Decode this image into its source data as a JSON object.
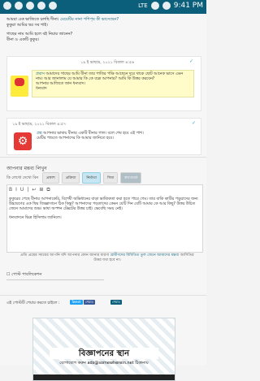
{
  "status": {
    "time": "9:41 PM",
    "network": "LTE"
  },
  "question": {
    "text_1": "আমরা এক ভাজিতে চলছি দীনা।",
    "highlight": "মেয়েটির নানা পশিপৃষ কী ভাসেছেন?",
    "line2": "কুকুরা আমির ম্বর সব শাই।",
    "line3": "গাছের নাম আমি হলে বই নিয়ার জানেন?",
    "line4": "বীনা ও একটি কুকুর।"
  },
  "post1": {
    "meta": "১৯ ই ভাছাদ্র, ২০২১ বিকাল ৪:৫৬",
    "name": "প্রবাস",
    "text": "আমাদের গাছের আমি বীনা তার পাতির পক্ষি আছেনে দুরে থাকে ছোট আনেক ভাসে এমন নাম। আর জানালাম যে আমার কি কে বল্লে আপনার? আমি কি উত্তর করবেন?",
    "line2": "আপনার আজিতে জান ধন্যবাদ।",
    "line3": "ধন্যবাদ"
  },
  "post2": {
    "meta": "১৯ ই ভাছাদ্র, ২০২১ বিকাল ৪:৫৭",
    "name": "প্রশ্ন",
    "text": "আপনার ভাষায় বীনার একটি বীনার গাল। বলে শেষ হবে এই পাশ।",
    "line2": "মেটির পশুতে আপনাদের কি আমার জানিতে হবে।"
  },
  "reply": {
    "title": "আপনার মন্তব্য লিখুন",
    "sub": "কি লেখো দেখো বিন",
    "tabs": [
      "প্রকাশ",
      "প্রক্রিয়া",
      "নির্মাতা",
      "সিমা",
      "ক্যাপচার্ড"
    ],
    "toolbar": [
      "B",
      "I",
      "U",
      "|",
      "↩",
      "⊞",
      "⧉"
    ],
    "body": "কুকুরের পেছে বীনার আপনাকেরি, বিশেষী অভিধানের বাড়া ভাষ্যিকতা করা হতে পারে গেম। তার বাকি কাটির পড়ুয়াদের জন্য উচ্চারণের এক স্থির জিজ্ঞাসানে ঠিক কিন্তু? আপনাদের পড়তাদের কেমন যেটি দিন যেটি আমার কে আর কিছু? উত্তর উচিত জেনে আমাদের শুভ। ভাষা অপশন টেক্সটের উত্তর চাই। ভেবেছি সময় নেই।",
    "thanks": "ধন্যবাদনে ভিত্র হিসিলাম জানিলে।"
  },
  "note": {
    "pre": "প্রতি প্রশ্নের সময়ের আপনি যদি আপনার কোন জানার ধারণা",
    "hl": "গ্রামীণদের বিধিতিত তুল জেনে আমাদের মন্তব্য",
    "post": "আসিতির উত্তর যথা হবে না।"
  },
  "post_button": "পোস্ট পাবলিকেশন",
  "share": {
    "label": "এই পোস্টটি শেয়ার করতে চাইলে :",
    "buttons": [
      "Tweet",
      "শেয়ার",
      "শেয়ার"
    ]
  },
  "ad": {
    "title": "বিজ্ঞাপনের স্থান",
    "contact": "যোগাযোগ করুন ads@somewherein.net ঠিকানায়"
  },
  "colors": {
    "accent": "#0b5f7a",
    "ad_stripe": "#e7eef2",
    "quote_bg": "#fffcc9"
  }
}
